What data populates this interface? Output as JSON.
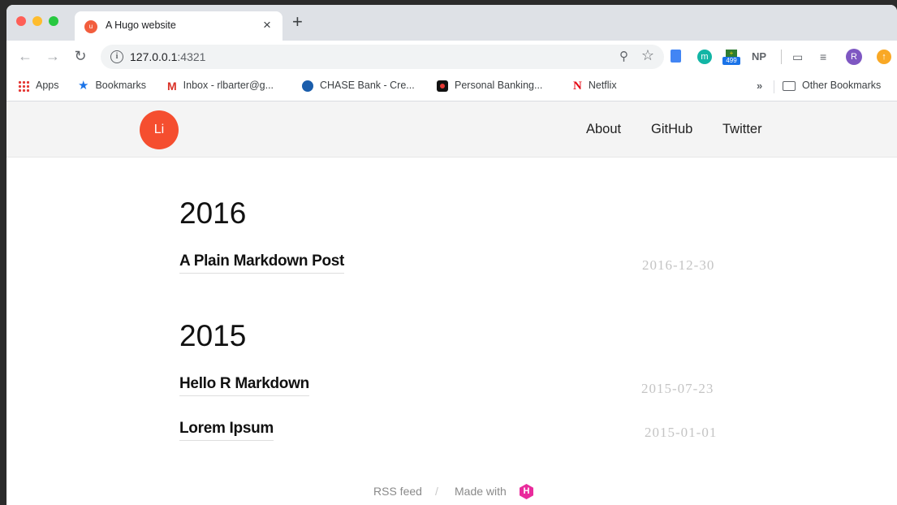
{
  "browser": {
    "tab_title": "A Hugo website",
    "tab_favicon": "u",
    "tab_close": "×",
    "new_tab": "+",
    "url_host": "127.0.0.1",
    "url_port": ":4321",
    "extensions": {
      "m": "m",
      "badge_count": "499",
      "np": "NP",
      "profile": "R"
    }
  },
  "bookmarks": {
    "items": [
      {
        "label": "Apps",
        "icon": "apps-grid-icon"
      },
      {
        "label": "Bookmarks",
        "icon": "star-icon"
      },
      {
        "label": "Inbox - rlbarter@g...",
        "icon": "gmail-icon"
      },
      {
        "label": "CHASE Bank - Cre...",
        "icon": "chase-icon"
      },
      {
        "label": "Personal Banking...",
        "icon": "bank-icon"
      },
      {
        "label": "Netflix",
        "icon": "netflix-icon"
      }
    ],
    "more": "»",
    "other": "Other Bookmarks"
  },
  "site": {
    "logo_text": "Li",
    "nav": [
      "About",
      "GitHub",
      "Twitter"
    ]
  },
  "archive": [
    {
      "year": "2016",
      "posts": [
        {
          "title": "A Plain Markdown Post",
          "date": "2016-12-30"
        }
      ]
    },
    {
      "year": "2015",
      "posts": [
        {
          "title": "Hello R Markdown",
          "date": "2015-07-23"
        },
        {
          "title": "Lorem Ipsum",
          "date": "2015-01-01"
        }
      ]
    }
  ],
  "footer": {
    "rss": "RSS feed",
    "separator": "/",
    "made_with": "Made with",
    "hugo_letter": "H"
  },
  "colors": {
    "accent": "#f54e2f",
    "hugo": "#e92b9c"
  }
}
